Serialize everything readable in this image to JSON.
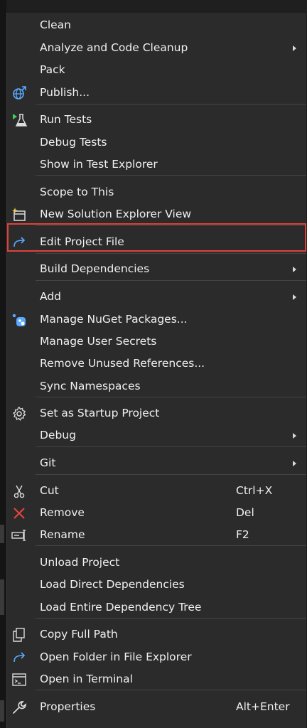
{
  "menu": {
    "items": [
      {
        "id": "clean",
        "label": "Clean",
        "icon": "",
        "shortcut": "",
        "submenu": false
      },
      {
        "id": "analyze",
        "label": "Analyze and Code Cleanup",
        "icon": "",
        "shortcut": "",
        "submenu": true
      },
      {
        "id": "pack",
        "label": "Pack",
        "icon": "",
        "shortcut": "",
        "submenu": false
      },
      {
        "id": "publish",
        "label": "Publish...",
        "icon": "globe-publish-icon",
        "shortcut": "",
        "submenu": false
      },
      {
        "id": "run-tests",
        "label": "Run Tests",
        "icon": "run-tests-flask-icon",
        "shortcut": "",
        "submenu": false
      },
      {
        "id": "debug-tests",
        "label": "Debug Tests",
        "icon": "",
        "shortcut": "",
        "submenu": false
      },
      {
        "id": "show-test-explorer",
        "label": "Show in Test Explorer",
        "icon": "",
        "shortcut": "",
        "submenu": false
      },
      {
        "id": "scope-to-this",
        "label": "Scope to This",
        "icon": "",
        "shortcut": "",
        "submenu": false
      },
      {
        "id": "new-solution-explorer-view",
        "label": "New Solution Explorer View",
        "icon": "new-window-icon",
        "shortcut": "",
        "submenu": false
      },
      {
        "id": "edit-project-file",
        "label": "Edit Project File",
        "icon": "redirect-arrow-icon",
        "shortcut": "",
        "submenu": false
      },
      {
        "id": "build-dependencies",
        "label": "Build Dependencies",
        "icon": "",
        "shortcut": "",
        "submenu": true
      },
      {
        "id": "add",
        "label": "Add",
        "icon": "",
        "shortcut": "",
        "submenu": true
      },
      {
        "id": "manage-nuget",
        "label": "Manage NuGet Packages...",
        "icon": "nuget-icon",
        "shortcut": "",
        "submenu": false
      },
      {
        "id": "manage-user-secrets",
        "label": "Manage User Secrets",
        "icon": "",
        "shortcut": "",
        "submenu": false
      },
      {
        "id": "remove-unused-references",
        "label": "Remove Unused References...",
        "icon": "",
        "shortcut": "",
        "submenu": false
      },
      {
        "id": "sync-namespaces",
        "label": "Sync Namespaces",
        "icon": "",
        "shortcut": "",
        "submenu": false
      },
      {
        "id": "set-startup-project",
        "label": "Set as Startup Project",
        "icon": "gear-icon",
        "shortcut": "",
        "submenu": false
      },
      {
        "id": "debug",
        "label": "Debug",
        "icon": "",
        "shortcut": "",
        "submenu": true
      },
      {
        "id": "git",
        "label": "Git",
        "icon": "",
        "shortcut": "",
        "submenu": true
      },
      {
        "id": "cut",
        "label": "Cut",
        "icon": "scissors-icon",
        "shortcut": "Ctrl+X",
        "submenu": false
      },
      {
        "id": "remove",
        "label": "Remove",
        "icon": "red-x-icon",
        "shortcut": "Del",
        "submenu": false
      },
      {
        "id": "rename",
        "label": "Rename",
        "icon": "rename-icon",
        "shortcut": "F2",
        "submenu": false
      },
      {
        "id": "unload-project",
        "label": "Unload Project",
        "icon": "",
        "shortcut": "",
        "submenu": false
      },
      {
        "id": "load-direct-dependencies",
        "label": "Load Direct Dependencies",
        "icon": "",
        "shortcut": "",
        "submenu": false
      },
      {
        "id": "load-entire-dependency-tree",
        "label": "Load Entire Dependency Tree",
        "icon": "",
        "shortcut": "",
        "submenu": false
      },
      {
        "id": "copy-full-path",
        "label": "Copy Full Path",
        "icon": "copy-icon",
        "shortcut": "",
        "submenu": false
      },
      {
        "id": "open-folder",
        "label": "Open Folder in File Explorer",
        "icon": "redirect-arrow-icon",
        "shortcut": "",
        "submenu": false
      },
      {
        "id": "open-terminal",
        "label": "Open in Terminal",
        "icon": "terminal-icon",
        "shortcut": "",
        "submenu": false
      },
      {
        "id": "properties",
        "label": "Properties",
        "icon": "wrench-icon",
        "shortcut": "Alt+Enter",
        "submenu": false
      }
    ],
    "highlighted_item": "edit-project-file",
    "colors": {
      "background": "#2b2b2b",
      "text": "#f0f0f0",
      "highlight_border": "#e0423a",
      "separator": "#444444"
    }
  }
}
